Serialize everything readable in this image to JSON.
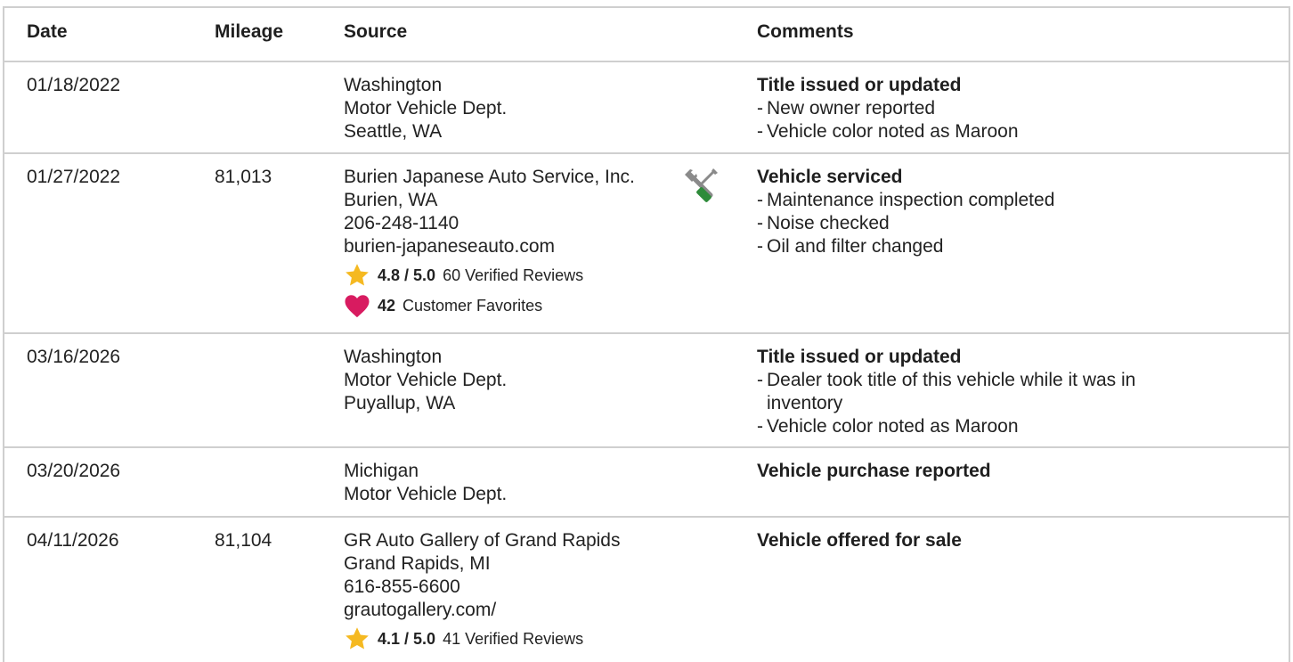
{
  "headers": {
    "date": "Date",
    "mileage": "Mileage",
    "source": "Source",
    "comments": "Comments"
  },
  "rows": [
    {
      "date": "01/18/2022",
      "mileage": "",
      "source": [
        "Washington",
        "Motor Vehicle Dept.",
        "Seattle, WA"
      ],
      "comment_title": "Title issued or updated",
      "comment_items": [
        "New owner reported",
        "Vehicle color noted as Maroon"
      ]
    },
    {
      "date": "01/27/2022",
      "mileage": "81,013",
      "source": [
        "Burien Japanese Auto Service, Inc.",
        "Burien, WA",
        "206-248-1140",
        "burien-japaneseauto.com"
      ],
      "rating": "4.8 / 5.0",
      "reviews": "60 Verified Reviews",
      "favorites_count": "42",
      "favorites_label": "Customer Favorites",
      "service_icon": "wrench-screwdriver-icon",
      "comment_title": "Vehicle serviced",
      "comment_items": [
        "Maintenance inspection completed",
        "Noise checked",
        "Oil and filter changed"
      ]
    },
    {
      "date": "03/16/2026",
      "mileage": "",
      "source": [
        "Washington",
        "Motor Vehicle Dept.",
        "Puyallup, WA"
      ],
      "comment_title": "Title issued or updated",
      "comment_items": [
        "Dealer took title of this vehicle while it was in inventory",
        "Vehicle color noted as Maroon"
      ]
    },
    {
      "date": "03/20/2026",
      "mileage": "",
      "source": [
        "Michigan",
        "Motor Vehicle Dept."
      ],
      "comment_title": "Vehicle purchase reported",
      "comment_items": []
    },
    {
      "date": "04/11/2026",
      "mileage": "81,104",
      "source": [
        "GR Auto Gallery of Grand Rapids",
        "Grand Rapids, MI",
        "616-855-6600",
        "grautogallery.com/"
      ],
      "rating": "4.1 / 5.0",
      "reviews": "41 Verified Reviews",
      "comment_title": "Vehicle offered for sale",
      "comment_items": []
    }
  ],
  "colors": {
    "star": "#F5B921",
    "heart": "#D81B60",
    "tool_gray": "#8a8a8a",
    "tool_green": "#2e8b3a",
    "border": "#cfcfcf"
  }
}
